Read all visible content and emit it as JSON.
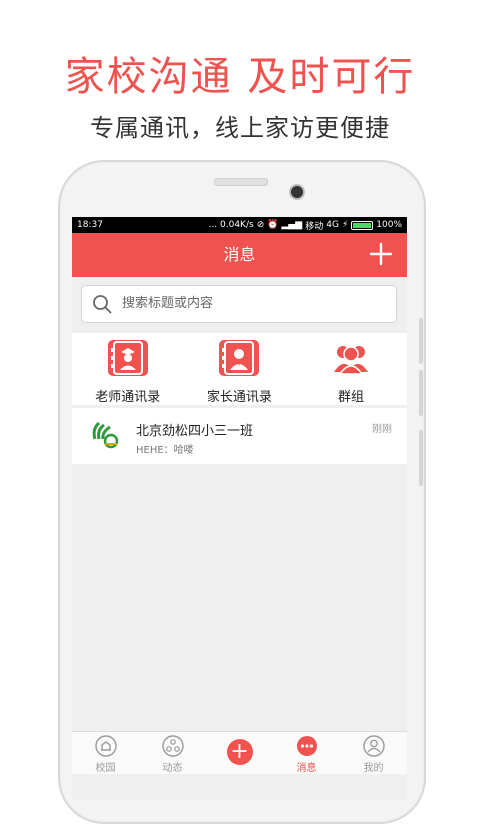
{
  "promo": {
    "headline": "家校沟通 及时可行",
    "subline": "专属通讯，线上家访更便捷"
  },
  "status_bar": {
    "time": "18:37",
    "network_speed": "... 0.04K/s",
    "carrier": "移动",
    "network_type": "4G",
    "battery": "100%",
    "battery_level": 1.0
  },
  "nav": {
    "title": "消息",
    "add_icon": "plus-icon"
  },
  "search": {
    "placeholder": "搜索标题或内容",
    "icon": "search-icon"
  },
  "quick_links": [
    {
      "label": "老师通讯录",
      "icon": "teacher-icon"
    },
    {
      "label": "家长通讯录",
      "icon": "parent-icon"
    },
    {
      "label": "群组",
      "icon": "group-icon"
    }
  ],
  "messages": [
    {
      "title": "北京劲松四小三一班",
      "preview": "HEHE：哈喽",
      "time": "刚刚",
      "avatar": "school-logo"
    }
  ],
  "tabbar": {
    "items": [
      {
        "label": "校园",
        "icon": "campus-icon",
        "active": false
      },
      {
        "label": "动态",
        "icon": "activity-icon",
        "active": false
      },
      {
        "label": "",
        "icon": "add-circle-icon",
        "active": false
      },
      {
        "label": "消息",
        "icon": "message-icon",
        "active": true
      },
      {
        "label": "我的",
        "icon": "profile-icon",
        "active": false
      }
    ]
  },
  "colors": {
    "accent": "#f0524f",
    "background": "#efefef"
  }
}
